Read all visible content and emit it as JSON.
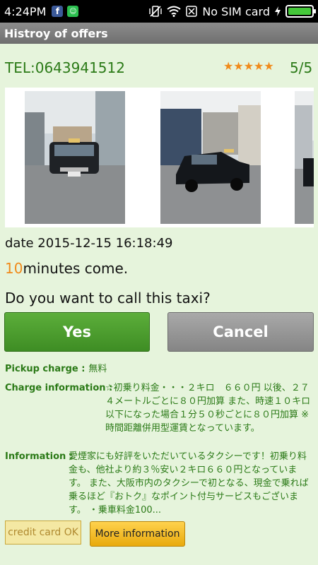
{
  "status_bar": {
    "time": "4:24PM",
    "carrier": "No SIM card",
    "icons": [
      "facebook-icon",
      "android-icon",
      "vibrate-icon",
      "wifi-icon",
      "sim-icon",
      "charging-icon",
      "battery-icon"
    ]
  },
  "header": {
    "title": "Histroy of offers"
  },
  "offer": {
    "tel": "TEL:0643941512",
    "stars": "★★★★★",
    "rating": "5/5",
    "date": "date 2015-12-15 16:18:49",
    "minutes_value": "10",
    "minutes_suffix": "minutes come.",
    "question": "Do you want to call this taxi?"
  },
  "actions": {
    "yes": "Yes",
    "cancel": "Cancel"
  },
  "details": {
    "pickup_label": "Pickup charge :",
    "pickup_value": "無料",
    "charge_label": "Charge information :",
    "charge_value": "☆初乗り料金・・・２キロ　６６０円 以後、２７４メートルごとに８０円加算 また、時速１０キロ以下になった場合１分５０秒ごとに８０円加算 ※時間距離併用型運賃となっています。",
    "info_label": "Information :",
    "info_value": "愛煙家にも好評をいただいているタクシーです！初乗り料金も、他社より約３％安い２キロ６６０円となっています。 また、大阪市内のタクシーで初となる、現金で乗れば乗るほど『おトク』なポイント付与サービスもございます。 ・乗車料金100..."
  },
  "footer": {
    "credit": "credit card OK",
    "more": "More information"
  },
  "colors": {
    "accent_green": "#2b7a17",
    "accent_orange": "#f08a1a",
    "background": "#e6f4dc"
  }
}
